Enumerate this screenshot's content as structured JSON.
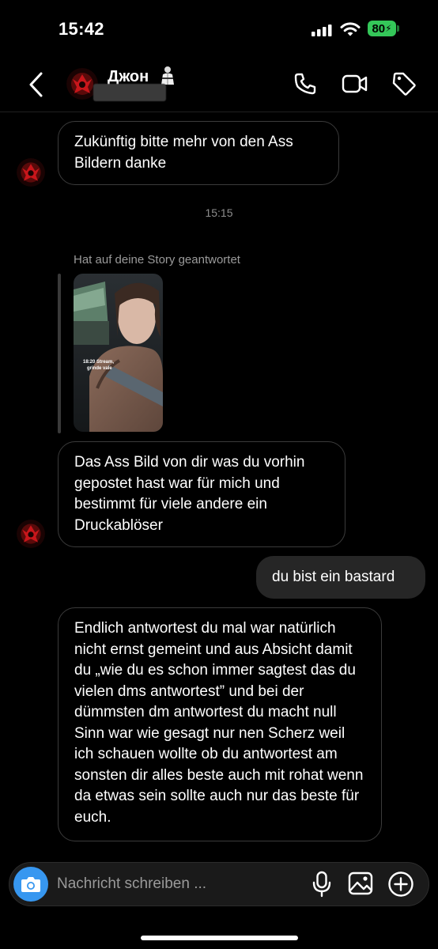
{
  "status_bar": {
    "time": "15:42",
    "battery": "80",
    "icons": [
      "cellular-signal-icon",
      "wifi-icon",
      "battery-charging-icon"
    ]
  },
  "header": {
    "contact_name": "Джон",
    "icons": [
      "back-chevron-icon",
      "phone-icon",
      "video-camera-icon",
      "tag-icon"
    ]
  },
  "messages": [
    {
      "direction": "incoming",
      "text": "Zukünftig bitte mehr von den Ass Bildern danke"
    },
    {
      "type": "timestamp",
      "text": "15:15"
    },
    {
      "type": "story_reply",
      "label": "Hat auf deine Story geantwortet",
      "story_overlay_text": "18:20 Stream grinde vale"
    },
    {
      "direction": "incoming",
      "text": "Das Ass Bild von dir was du vorhin gepostet hast war für mich und bestimmt für viele andere ein Druckablöser"
    },
    {
      "direction": "outgoing",
      "text": "du bist ein bastard"
    },
    {
      "direction": "incoming",
      "text": "Endlich antwortest du mal war natürlich nicht ernst gemeint und aus Absicht damit du „wie du es schon immer sagtest das du vielen dms antwortest” und bei der dümmsten dm antwortest du macht null Sinn war wie gesagt nur nen Scherz weil ich schauen wollte ob du antwortest am sonsten dir alles beste auch mit rohat wenn da etwas sein sollte auch nur das beste für euch."
    }
  ],
  "composer": {
    "placeholder": "Nachricht schreiben ...",
    "value": "",
    "icons": [
      "camera-icon",
      "microphone-icon",
      "gallery-icon",
      "plus-circle-icon"
    ]
  },
  "colors": {
    "background": "#000000",
    "outgoing_bubble": "#262626",
    "accent": "#3797f0",
    "battery": "#34c759"
  }
}
